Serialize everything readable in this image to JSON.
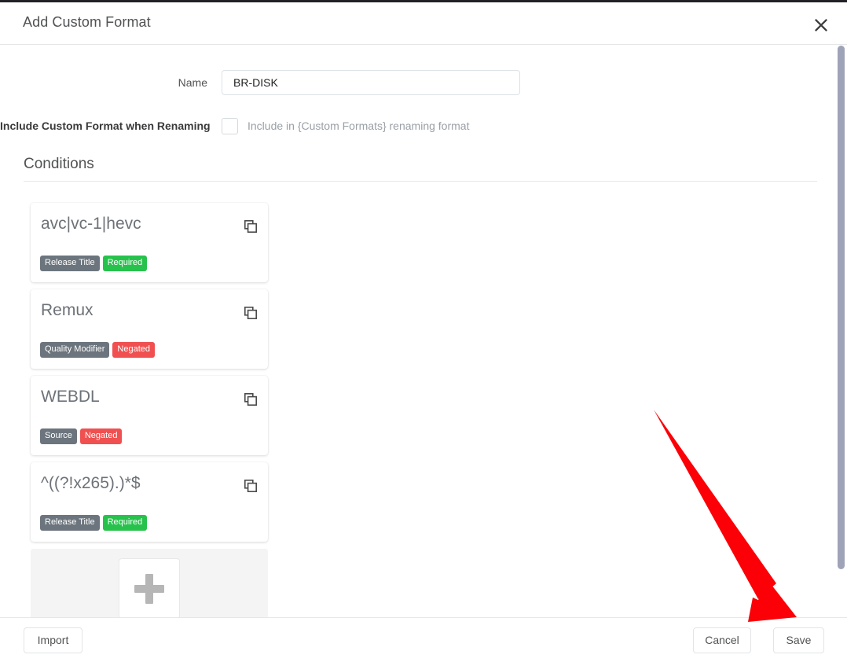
{
  "window": {
    "title": "Add Custom Format",
    "close_icon": "close-icon"
  },
  "form": {
    "name_label": "Name",
    "name_value": "BR-DISK",
    "name_placeholder": "",
    "include_label": "Include Custom Format when Renaming",
    "include_checkbox_label": "Include in {Custom Formats} renaming format",
    "include_checked": false
  },
  "conditions": {
    "section_title": "Conditions",
    "copy_icon": "copy-icon",
    "add_icon": "plus-icon",
    "cards": [
      {
        "name": "avc|vc-1|hevc",
        "kind": "Release Title",
        "state": "Required",
        "state_color": "#27c24c"
      },
      {
        "name": "Remux",
        "kind": "Quality Modifier",
        "state": "Negated",
        "state_color": "#f05050"
      },
      {
        "name": "WEBDL",
        "kind": "Source",
        "state": "Negated",
        "state_color": "#f05050"
      },
      {
        "name": "^((?!x265).)*$",
        "kind": "Release Title",
        "state": "Required",
        "state_color": "#27c24c"
      }
    ]
  },
  "footer": {
    "import_label": "Import",
    "cancel_label": "Cancel",
    "save_label": "Save"
  },
  "annotation": {
    "arrow_color": "#fb0007",
    "points_to": "Save"
  },
  "scrollbar": {
    "thumb_color": "#9ea3b8"
  }
}
